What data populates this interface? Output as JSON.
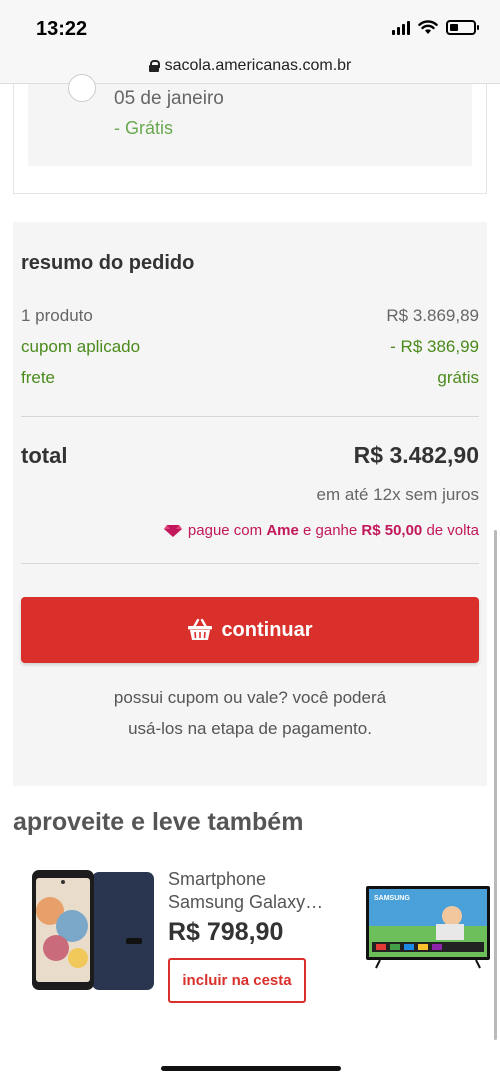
{
  "status_bar": {
    "time": "13:22",
    "battery_level": 0.35
  },
  "browser": {
    "url": "sacola.americanas.com.br"
  },
  "delivery_option": {
    "date": "05 de janeiro",
    "price": "- Grátis"
  },
  "summary": {
    "title": "resumo do pedido",
    "products_label": "1 produto",
    "products_value": "R$ 3.869,89",
    "coupon_label": "cupom aplicado",
    "coupon_value": "- R$ 386,99",
    "shipping_label": "frete",
    "shipping_value": "grátis",
    "total_label": "total",
    "total_value": "R$ 3.482,90",
    "installments": "em até 12x sem juros",
    "ame_prefix": "pague com ",
    "ame_brand": "Ame",
    "ame_middle": " e ganhe ",
    "ame_amount": "R$ 50,00",
    "ame_suffix": " de volta",
    "continue_label": "continuar",
    "coupon_note_line1": "possui cupom ou vale? você poderá",
    "coupon_note_line2": "usá-los na etapa de pagamento."
  },
  "recommendations": {
    "title": "aproveite e leve também",
    "product": {
      "name": "Smartphone Samsung Galaxy…",
      "price": "R$ 798,90",
      "add_label": "incluir na cesta"
    },
    "tv_brand": "SAMSUNG"
  },
  "colors": {
    "accent_red": "#d9302b",
    "green": "#4b8a1c",
    "ame_pink": "#c2185b"
  }
}
